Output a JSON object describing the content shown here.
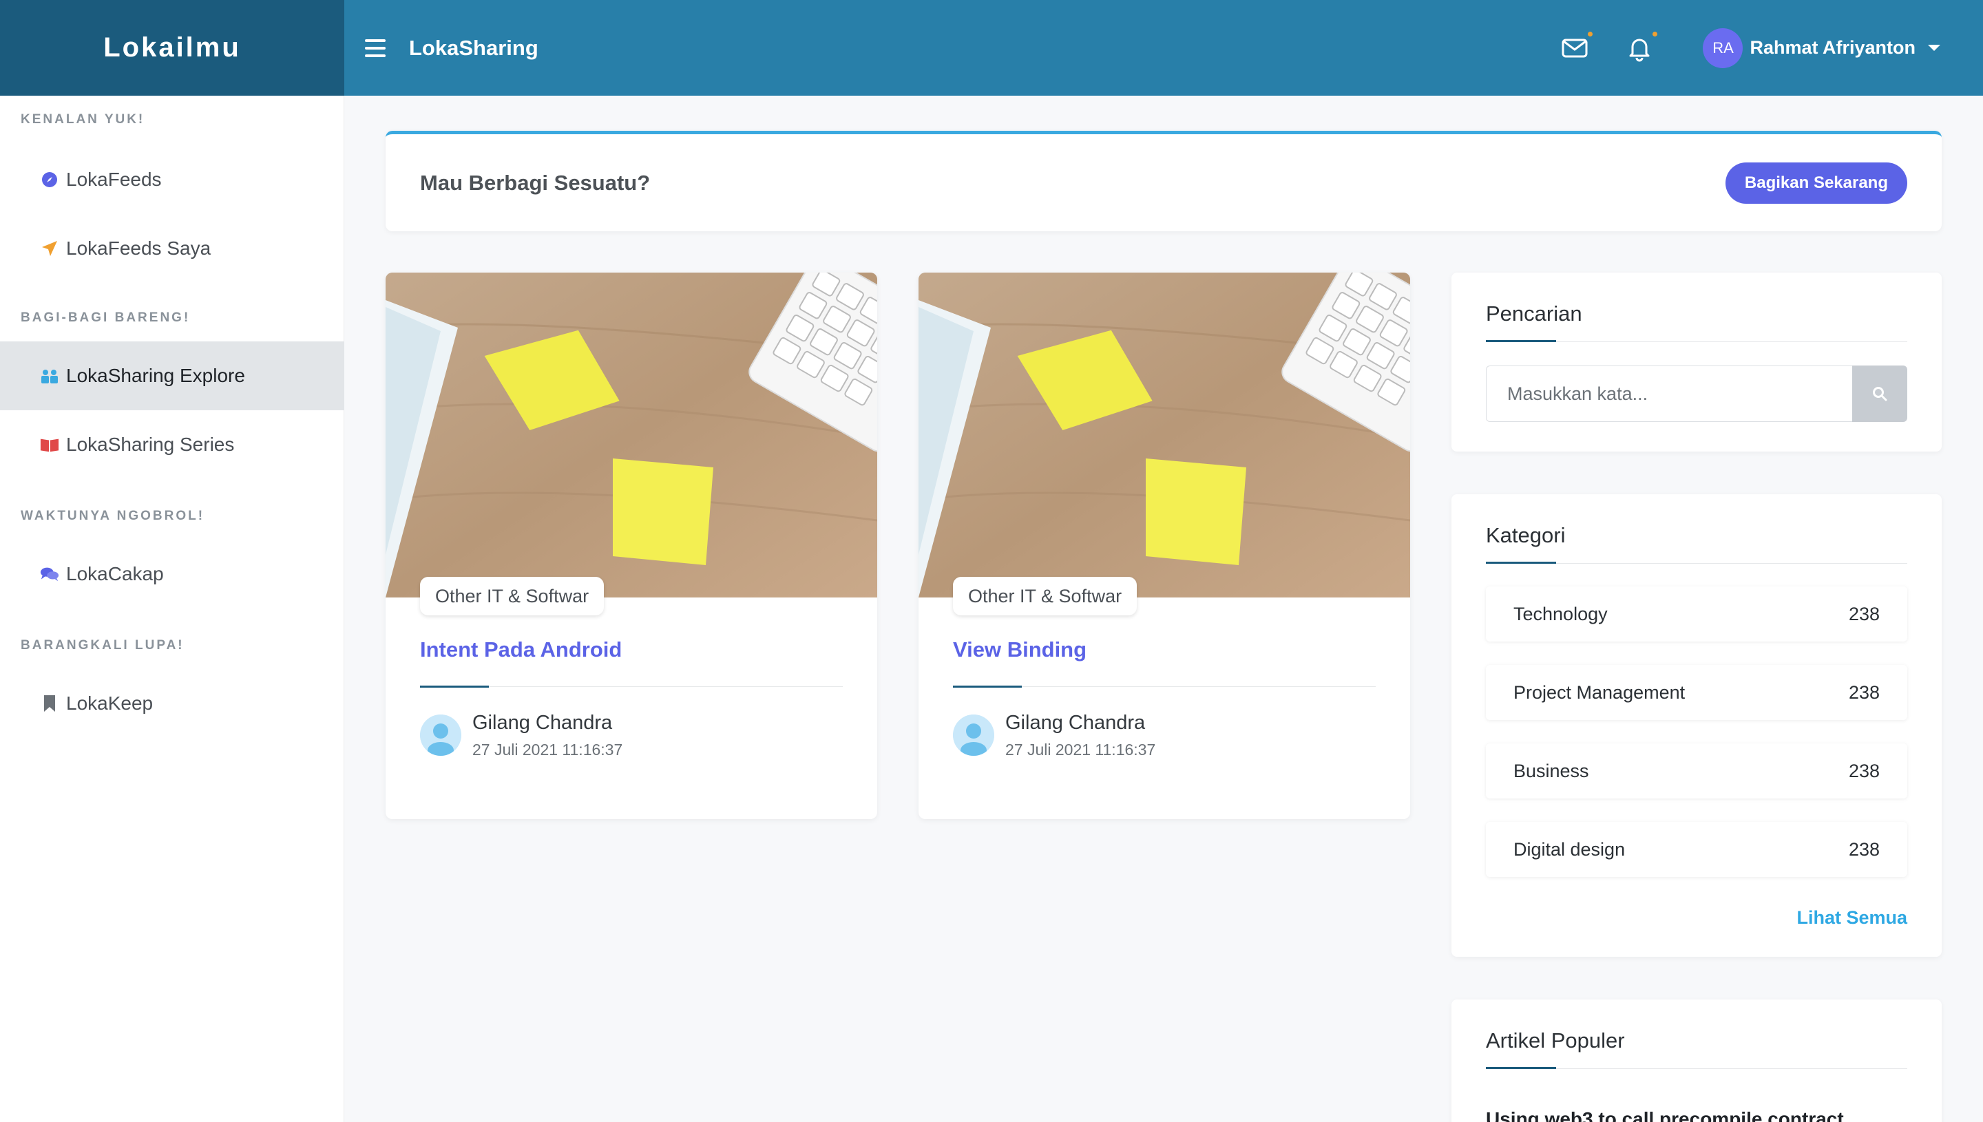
{
  "brand": "Lokailmu",
  "topbar": {
    "title": "LokaSharing",
    "user_initials": "RA",
    "user_name": "Rahmat Afriyanton"
  },
  "sidebar": {
    "sections": [
      {
        "heading": "KENALAN YUK!",
        "items": [
          {
            "label": "LokaFeeds",
            "icon": "compass-icon",
            "color": "#5b63e6"
          },
          {
            "label": "LokaFeeds Saya",
            "icon": "paper-plane-icon",
            "color": "#f0a030"
          }
        ]
      },
      {
        "heading": "BAGI-BAGI BARENG!",
        "items": [
          {
            "label": "LokaSharing Explore",
            "icon": "people-icon",
            "color": "#3aa9e0",
            "active": true
          },
          {
            "label": "LokaSharing Series",
            "icon": "book-icon",
            "color": "#e04848"
          }
        ]
      },
      {
        "heading": "WAKTUNYA NGOBROL!",
        "items": [
          {
            "label": "LokaCakap",
            "icon": "chat-icon",
            "color": "#5b63e6"
          }
        ]
      },
      {
        "heading": "BARANGKALI LUPA!",
        "items": [
          {
            "label": "LokaKeep",
            "icon": "bookmark-icon",
            "color": "#6b7177"
          }
        ]
      }
    ]
  },
  "share": {
    "question": "Mau Berbagi Sesuatu?",
    "button": "Bagikan Sekarang"
  },
  "posts": [
    {
      "tag": "Other IT & Softwar",
      "title": "Intent Pada Android",
      "author": "Gilang Chandra",
      "date": "27 Juli 2021 11:16:37"
    },
    {
      "tag": "Other IT & Softwar",
      "title": "View Binding",
      "author": "Gilang Chandra",
      "date": "27 Juli 2021 11:16:37"
    }
  ],
  "search": {
    "title": "Pencarian",
    "placeholder": "Masukkan kata..."
  },
  "categories": {
    "title": "Kategori",
    "items": [
      {
        "name": "Technology",
        "count": "238"
      },
      {
        "name": "Project Management",
        "count": "238"
      },
      {
        "name": "Business",
        "count": "238"
      },
      {
        "name": "Digital design",
        "count": "238"
      }
    ],
    "see_all": "Lihat Semua"
  },
  "popular": {
    "title": "Artikel Populer",
    "first_article": "Using web3 to call precompile contract"
  },
  "colors": {
    "brand_dark": "#1b5b7d",
    "topbar": "#287fa9",
    "accent": "#5b63e6",
    "link": "#2ea8e3"
  }
}
